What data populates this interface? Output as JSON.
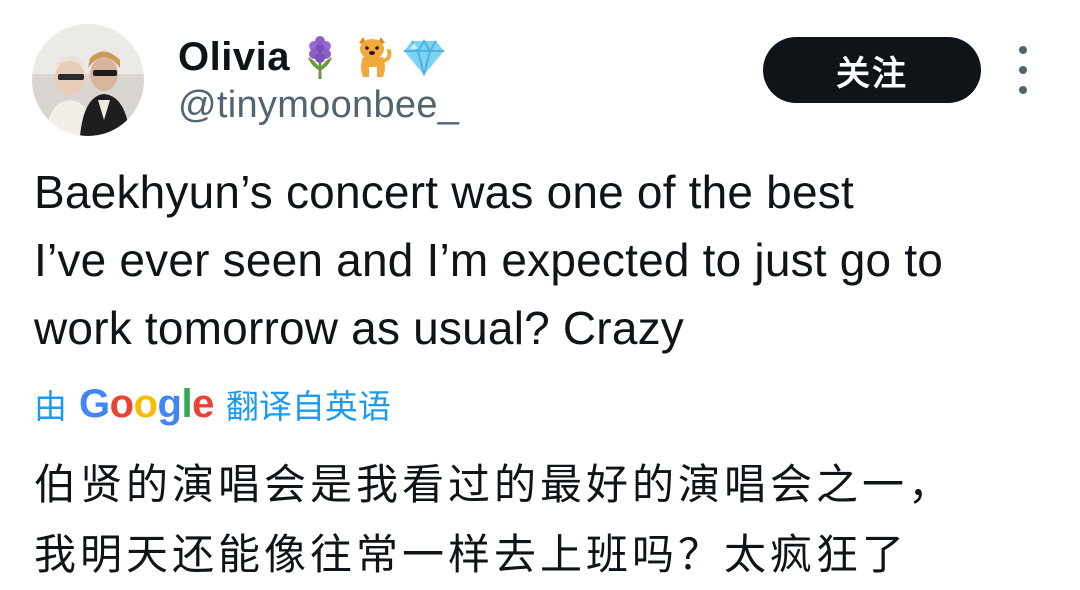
{
  "user": {
    "display_name": "Olivia",
    "handle": "@tinymoonbee_",
    "emoji_icons": [
      "hyacinth-icon",
      "dog-icon",
      "gem-icon"
    ]
  },
  "actions": {
    "follow_label": "关注",
    "more_icon": "more-vertical-icon"
  },
  "tweet": {
    "lines": [
      "Baekhyun’s concert was one of the best",
      "I’ve ever seen and I’m expected to just go to",
      "work tomorrow as usual? Crazy"
    ]
  },
  "translation": {
    "by_label": "由",
    "provider": "Google",
    "translated_from_label": "翻译自英语",
    "lines": [
      "伯贤的演唱会是我看过的最好的演唱会之一，",
      "我明天还能像往常一样去上班吗？太疯狂了"
    ]
  },
  "colors": {
    "text_primary": "#0f1419",
    "text_secondary": "#536471",
    "link_blue": "#1d9bf0",
    "button_bg": "#0f1419",
    "google_blue": "#4285f4",
    "google_red": "#ea4335",
    "google_yellow": "#fbbc05",
    "google_green": "#34a853"
  }
}
